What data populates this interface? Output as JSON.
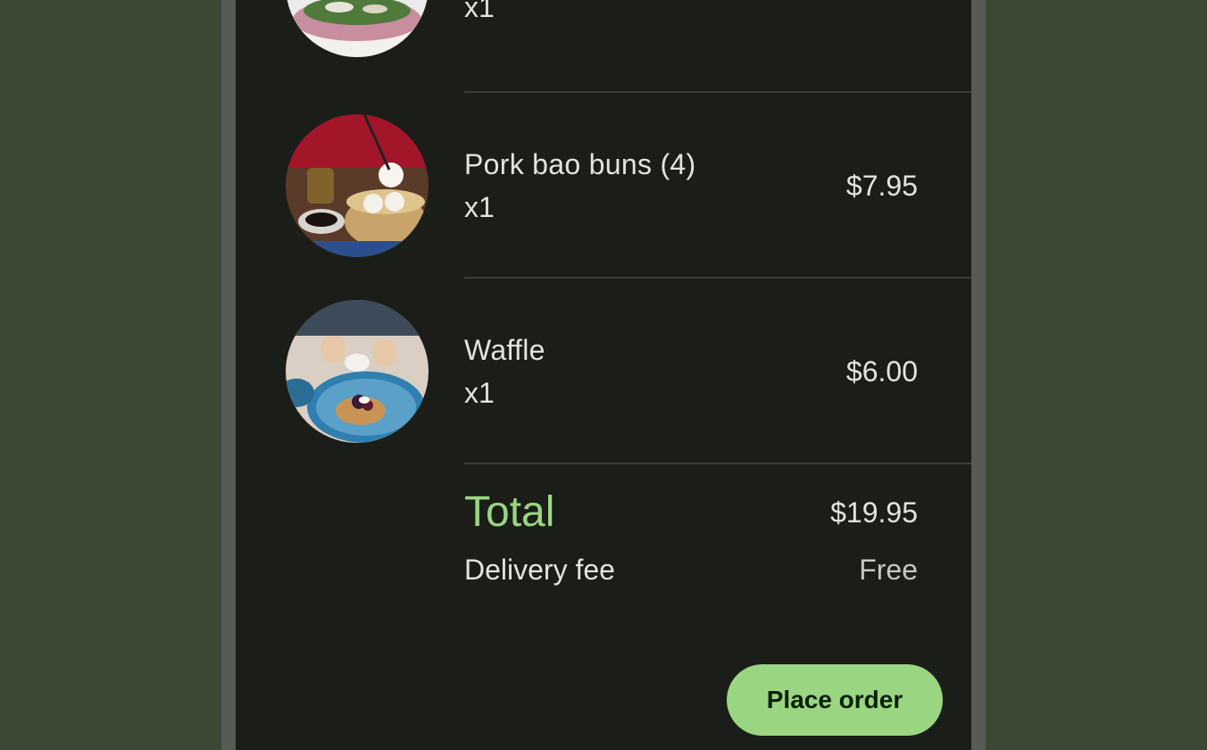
{
  "cart": {
    "items": [
      {
        "name": "",
        "qty": "x1",
        "price": "",
        "image": "salad-bowl-photo"
      },
      {
        "name": "Pork bao buns (4)",
        "qty": "x1",
        "price": "$7.95",
        "image": "bao-buns-photo"
      },
      {
        "name": "Waffle",
        "qty": "x1",
        "price": "$6.00",
        "image": "waffle-photo"
      }
    ]
  },
  "summary": {
    "total_label": "Total",
    "total_value": "$19.95",
    "delivery_fee_label": "Delivery fee",
    "delivery_fee_value": "Free"
  },
  "actions": {
    "place_order_label": "Place order"
  },
  "colors": {
    "accent": "#9ad682",
    "surface": "#1b1d19",
    "background": "#3c4734"
  }
}
